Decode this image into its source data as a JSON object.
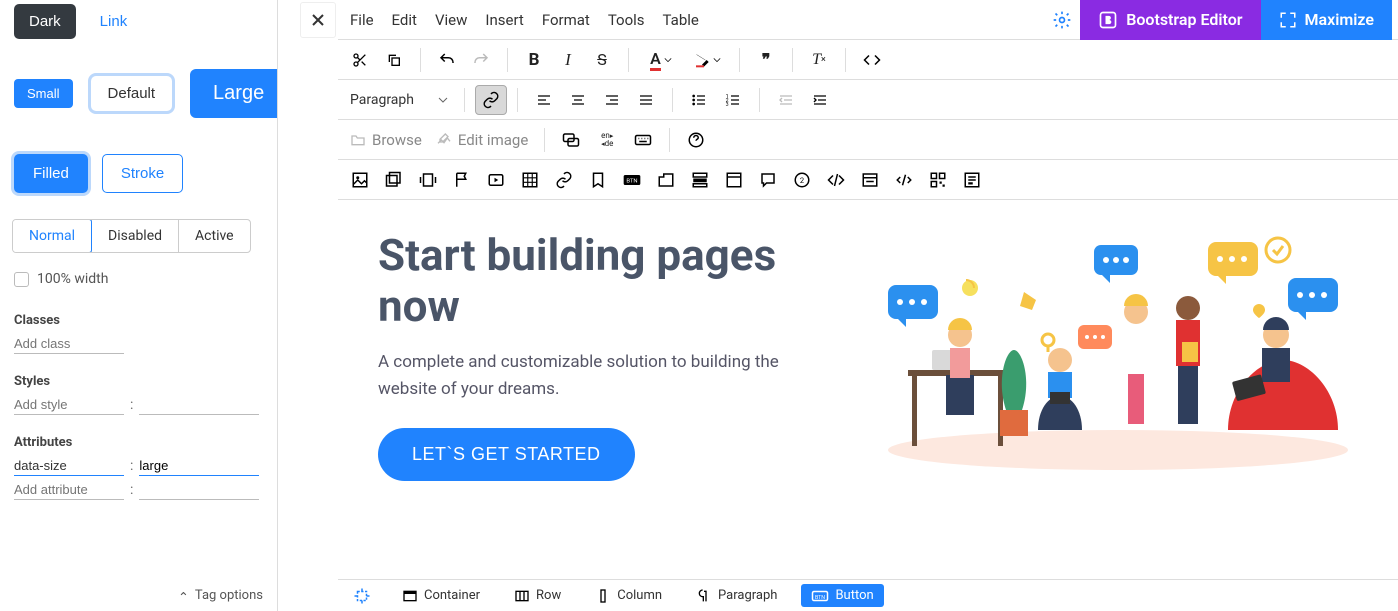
{
  "sidebar": {
    "variant_row": {
      "dark": "Dark",
      "link": "Link"
    },
    "sizes": {
      "small": "Small",
      "default": "Default",
      "large": "Large"
    },
    "fill": {
      "filled": "Filled",
      "stroke": "Stroke"
    },
    "states": [
      "Normal",
      "Disabled",
      "Active"
    ],
    "full_width_label": "100% width",
    "sections": {
      "classes": "Classes",
      "classes_placeholder": "Add class",
      "styles": "Styles",
      "styles_placeholder": "Add style",
      "attributes": "Attributes",
      "attr_name": "data-size",
      "attr_value": "large",
      "attr_placeholder": "Add attribute"
    },
    "tag_options": "Tag options"
  },
  "menu": [
    "File",
    "Edit",
    "View",
    "Insert",
    "Format",
    "Tools",
    "Table"
  ],
  "header_buttons": {
    "bootstrap": "Bootstrap Editor",
    "maximize": "Maximize"
  },
  "toolbar2": {
    "paragraph": "Paragraph"
  },
  "toolbar3": {
    "browse": "Browse",
    "edit_image": "Edit image",
    "lang_top": "en",
    "lang_bottom": "de"
  },
  "canvas": {
    "title": "Start building pages now",
    "subtitle": "A complete and customizable solution to building the website of your dreams.",
    "cta": "LET`S GET STARTED"
  },
  "crumbs": [
    "Container",
    "Row",
    "Column",
    "Paragraph",
    "Button"
  ]
}
